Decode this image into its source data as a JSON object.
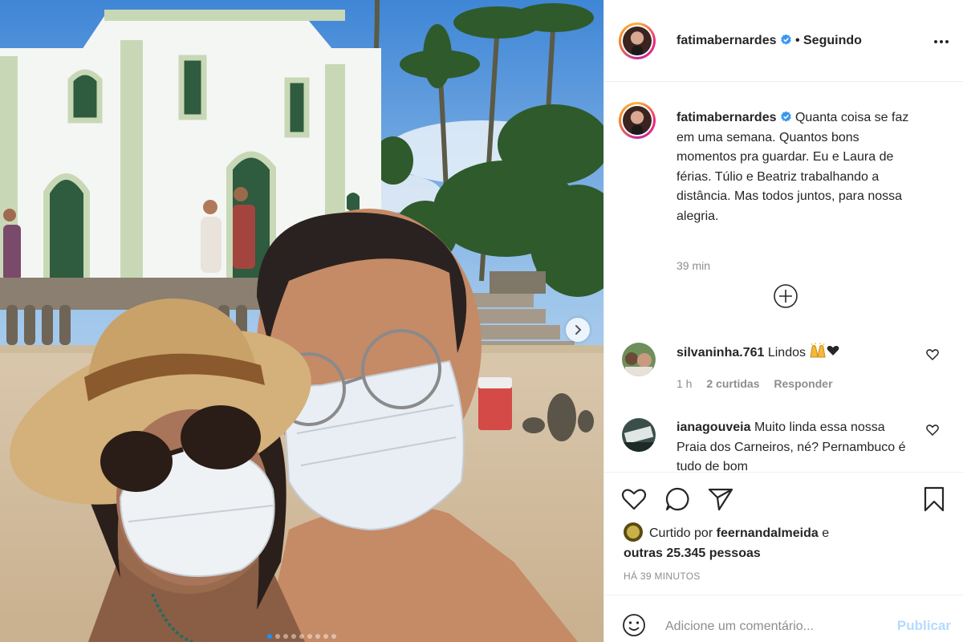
{
  "post": {
    "author": "fatimabernardes",
    "verified": true,
    "follow_status": "• Seguindo",
    "caption": "Quanta coisa se faz em uma semana. Quantos bons momentos pra guardar. Eu e Laura de férias. Túlio e Beatriz trabalhando a distância. Mas todos juntos, para nossa alegria.",
    "caption_time": "39 min",
    "liked_by_user": "feernandalmeida",
    "liked_by_prefix": "Curtido por",
    "liked_by_suffix": "e",
    "likes_others": "outras 25.345 pessoas",
    "posted_ago": "HÁ 39 MINUTOS",
    "carousel_slides": 9,
    "active_slide": 1
  },
  "comments": [
    {
      "user": "silvaninha.761",
      "text": "Lindos",
      "emojis": [
        "praising-hands-emoji",
        "black-heart-emoji"
      ],
      "time": "1 h",
      "likes": "2 curtidas",
      "reply": "Responder"
    },
    {
      "user": "ianagouveia",
      "text": "Muito linda essa nossa Praia dos Carneiros, né? Pernambuco é tudo de bom"
    }
  ],
  "add_comment": {
    "placeholder": "Adicione um comentário...",
    "publish_label": "Publicar"
  },
  "icons": {
    "more": "more-options-icon",
    "like": "heart-icon",
    "comment": "comment-bubble-icon",
    "share": "paper-plane-icon",
    "save": "bookmark-icon",
    "load_more": "plus-circle-icon",
    "emoji": "smile-icon",
    "next": "chevron-right-icon"
  },
  "colors": {
    "verified": "#3897f0",
    "publish_disabled": "#b3dbff",
    "muted_text": "#8e8e8e",
    "carousel_active_dot": "#1e90ff"
  }
}
